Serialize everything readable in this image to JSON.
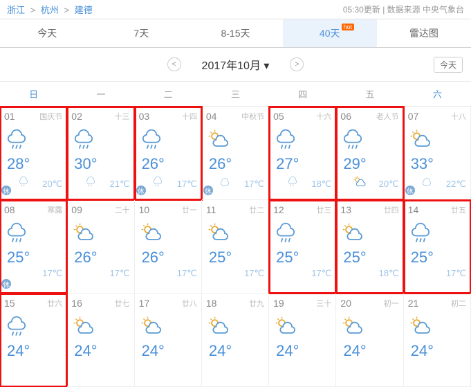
{
  "breadcrumb": {
    "p1": "浙江",
    "p2": "杭州",
    "p3": "建德",
    "sep": ">"
  },
  "meta": {
    "update": "05:30更新",
    "source": "数据来源 中央气象台",
    "sep": "|"
  },
  "tabs": [
    {
      "label": "今天"
    },
    {
      "label": "7天"
    },
    {
      "label": "8-15天"
    },
    {
      "label": "40天",
      "hot": "hot",
      "active": true
    },
    {
      "label": "雷达图"
    }
  ],
  "month": {
    "title": "2017年10月",
    "prev": "<",
    "next": ">",
    "today": "今天",
    "arrow": "▾"
  },
  "weekdays": [
    "日",
    "一",
    "二",
    "三",
    "四",
    "五",
    "六"
  ],
  "cells": [
    {
      "d": "01",
      "l": "国庆节",
      "hi": "28°",
      "lo": "20℃",
      "i1": "rain",
      "i2": "rain-n",
      "badge": "休",
      "hl": 1
    },
    {
      "d": "02",
      "l": "十三",
      "hi": "30°",
      "lo": "21℃",
      "i1": "rain",
      "i2": "rain-n",
      "hl": 1
    },
    {
      "d": "03",
      "l": "十四",
      "hi": "26°",
      "lo": "17℃",
      "i1": "rain",
      "i2": "rain-n",
      "badge": "休",
      "hl": 1
    },
    {
      "d": "04",
      "l": "中秋节",
      "hi": "26°",
      "lo": "17℃",
      "i1": "pcloud",
      "i2": "cloud",
      "badge": "休"
    },
    {
      "d": "05",
      "l": "十六",
      "hi": "27°",
      "lo": "18℃",
      "i1": "rain",
      "i2": "rain-n",
      "hl": 1
    },
    {
      "d": "06",
      "l": "老人节",
      "hi": "29°",
      "lo": "20℃",
      "i1": "rain",
      "i2": "pcloud",
      "hl": 1
    },
    {
      "d": "07",
      "l": "十八",
      "hi": "33°",
      "lo": "22℃",
      "i1": "pcloud",
      "i2": "cloud",
      "badge": "休"
    },
    {
      "d": "08",
      "l": "寒露",
      "hi": "25°",
      "lo": "17℃",
      "i1": "rain",
      "badge": "休",
      "hl": 1
    },
    {
      "d": "09",
      "l": "二十",
      "hi": "26°",
      "lo": "17℃",
      "i1": "pcloud"
    },
    {
      "d": "10",
      "l": "廿一",
      "hi": "26°",
      "lo": "17℃",
      "i1": "pcloud"
    },
    {
      "d": "11",
      "l": "廿二",
      "hi": "25°",
      "lo": "17℃",
      "i1": "pcloud"
    },
    {
      "d": "12",
      "l": "廿三",
      "hi": "25°",
      "lo": "17℃",
      "i1": "rain",
      "hl": 1
    },
    {
      "d": "13",
      "l": "廿四",
      "hi": "25°",
      "lo": "18℃",
      "i1": "pcloud",
      "hl": 1
    },
    {
      "d": "14",
      "l": "廿五",
      "hi": "25°",
      "lo": "17℃",
      "i1": "rain",
      "hl": 1
    },
    {
      "d": "15",
      "l": "廿六",
      "hi": "24°",
      "lo": "",
      "i1": "rain",
      "hl": 1
    },
    {
      "d": "16",
      "l": "廿七",
      "hi": "24°",
      "lo": "",
      "i1": "pcloud"
    },
    {
      "d": "17",
      "l": "廿八",
      "hi": "24°",
      "lo": "",
      "i1": "pcloud"
    },
    {
      "d": "18",
      "l": "廿九",
      "hi": "24°",
      "lo": "",
      "i1": "pcloud"
    },
    {
      "d": "19",
      "l": "三十",
      "hi": "24°",
      "lo": "",
      "i1": "pcloud"
    },
    {
      "d": "20",
      "l": "初一",
      "hi": "24°",
      "lo": "",
      "i1": "pcloud"
    },
    {
      "d": "21",
      "l": "初二",
      "hi": "24°",
      "lo": "",
      "i1": "pcloud"
    }
  ]
}
